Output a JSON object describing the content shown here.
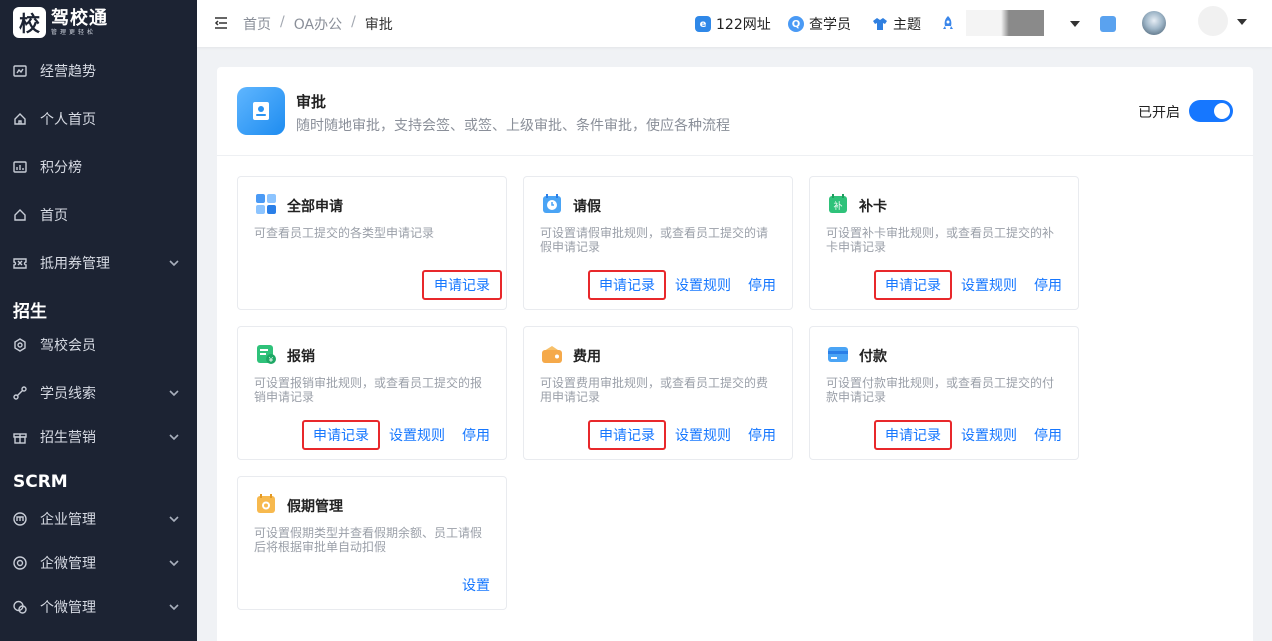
{
  "sidebar": {
    "logo_mark": "校",
    "logo_name": "驾校通",
    "logo_slogan": "管理更轻松",
    "items": [
      {
        "label": "经营趋势",
        "icon": "chart-icon"
      },
      {
        "label": "个人首页",
        "icon": "home-icon"
      },
      {
        "label": "积分榜",
        "icon": "rank-icon"
      },
      {
        "label": "首页",
        "icon": "home-icon"
      },
      {
        "label": "抵用券管理",
        "icon": "coupon-icon"
      },
      {
        "label": "驾校会员",
        "icon": "member-icon"
      },
      {
        "label": "学员线索",
        "icon": "lead-icon"
      },
      {
        "label": "招生营销",
        "icon": "gift-icon"
      },
      {
        "label": "企业管理",
        "icon": "enterprise-icon"
      },
      {
        "label": "企微管理",
        "icon": "wecom-icon"
      },
      {
        "label": "个微管理",
        "icon": "wechat-icon"
      }
    ],
    "section_zhaosheng": "招生",
    "section_scrm": "SCRM"
  },
  "header": {
    "breadcrumb": [
      "首页",
      "OA办公",
      "审批"
    ],
    "links": {
      "site122": "122网址",
      "search_student": "查学员",
      "theme": "主题"
    }
  },
  "app": {
    "title": "审批",
    "desc": "随时随地审批，支持会签、或签、上级审批、条件审批，使应各种流程",
    "status_label": "已开启",
    "enabled": true
  },
  "cards": [
    {
      "title": "全部申请",
      "desc": "可查看员工提交的各类型申请记录",
      "actions": [
        "申请记录"
      ]
    },
    {
      "title": "请假",
      "desc": "可设置请假审批规则，或查看员工提交的请假申请记录",
      "actions": [
        "申请记录",
        "设置规则",
        "停用"
      ]
    },
    {
      "title": "补卡",
      "desc": "可设置补卡审批规则，或查看员工提交的补卡申请记录",
      "actions": [
        "申请记录",
        "设置规则",
        "停用"
      ]
    },
    {
      "title": "报销",
      "desc": "可设置报销审批规则，或查看员工提交的报销申请记录",
      "actions": [
        "申请记录",
        "设置规则",
        "停用"
      ]
    },
    {
      "title": "费用",
      "desc": "可设置费用审批规则，或查看员工提交的费用申请记录",
      "actions": [
        "申请记录",
        "设置规则",
        "停用"
      ]
    },
    {
      "title": "付款",
      "desc": "可设置付款审批规则，或查看员工提交的付款申请记录",
      "actions": [
        "申请记录",
        "设置规则",
        "停用"
      ]
    },
    {
      "title": "假期管理",
      "desc": "可设置假期类型并查看假期余额、员工请假后将根据审批单自动扣假",
      "actions": [
        "设置"
      ]
    }
  ],
  "colors": {
    "sidebar_bg": "#1c2333",
    "accent": "#1677ff",
    "highlight_box": "#e8282b"
  }
}
